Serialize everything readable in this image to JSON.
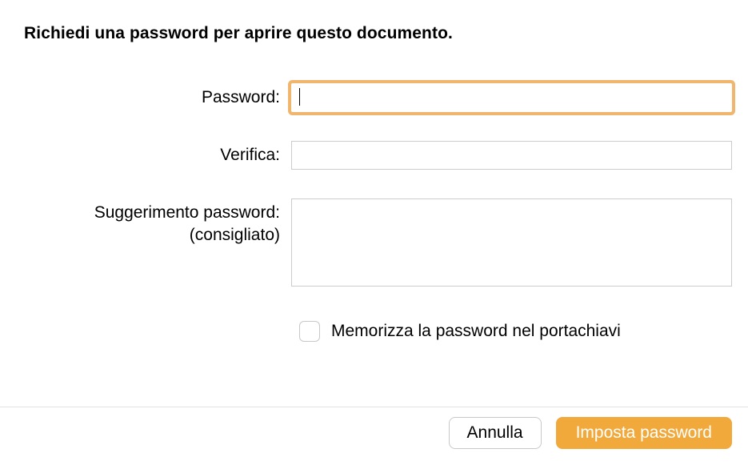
{
  "dialog": {
    "title": "Richiedi una password per aprire questo documento."
  },
  "fields": {
    "password_label": "Password:",
    "password_value": "",
    "verify_label": "Verifica:",
    "verify_value": "",
    "hint_label_line1": "Suggerimento password:",
    "hint_label_line2": "(consigliato)",
    "hint_value": ""
  },
  "checkbox": {
    "label": "Memorizza la password nel portachiavi",
    "checked": false
  },
  "buttons": {
    "cancel": "Annulla",
    "set_password": "Imposta password"
  }
}
